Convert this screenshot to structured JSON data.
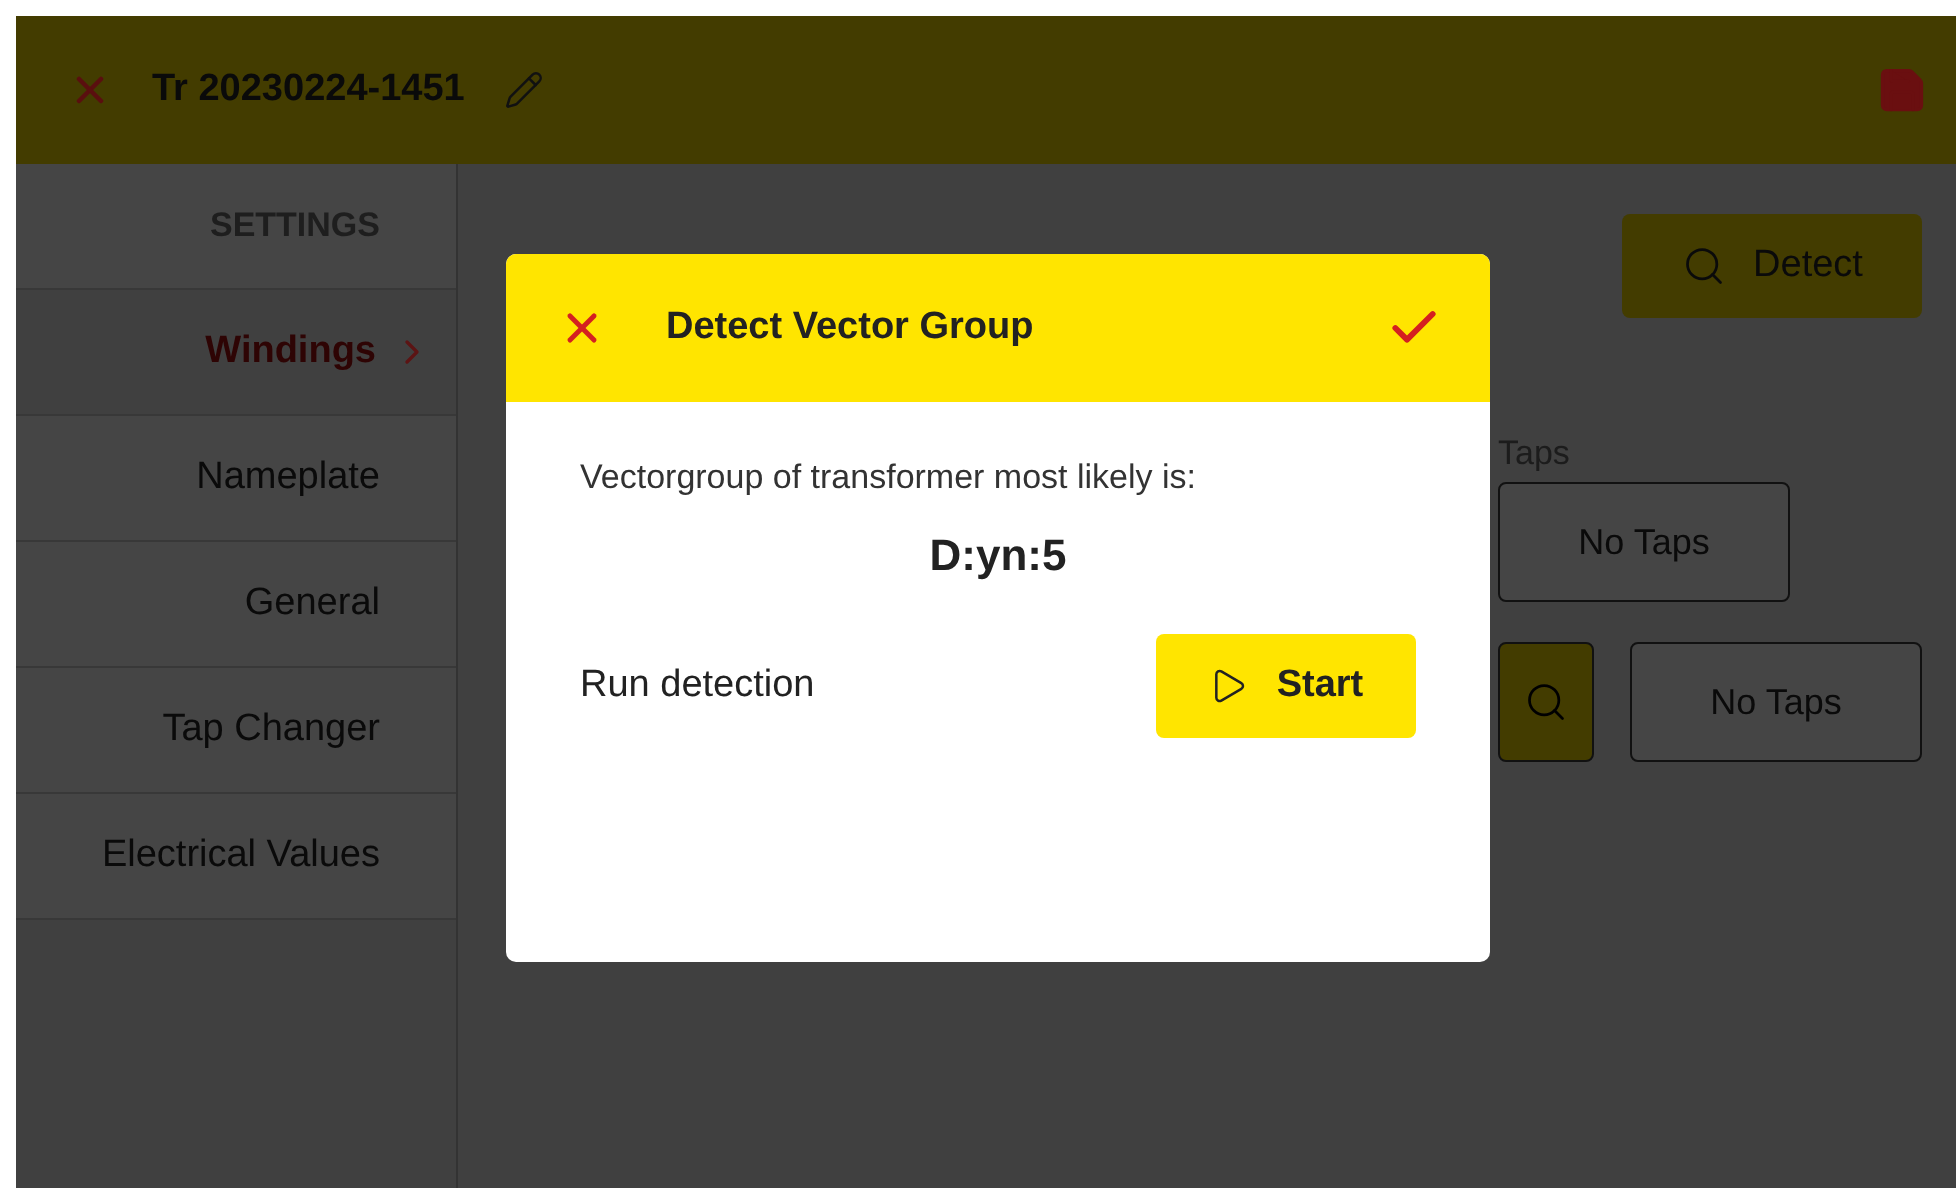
{
  "header": {
    "title": "Tr 20230224-1451"
  },
  "sidebar": {
    "heading": "SETTINGS",
    "items": [
      {
        "label": "Windings",
        "selected": true
      },
      {
        "label": "Nameplate",
        "selected": false
      },
      {
        "label": "General",
        "selected": false
      },
      {
        "label": "Tap Changer",
        "selected": false
      },
      {
        "label": "Electrical Values",
        "selected": false
      }
    ]
  },
  "main": {
    "detect_button": "Detect",
    "taps_label": "Taps",
    "tap_fields": [
      {
        "value": "No Taps"
      },
      {
        "value": "No Taps"
      }
    ]
  },
  "dialog": {
    "title": "Detect Vector Group",
    "message": "Vectorgroup of transformer most likely is:",
    "result": "D:yn:5",
    "run_label": "Run detection",
    "start_button": "Start"
  }
}
